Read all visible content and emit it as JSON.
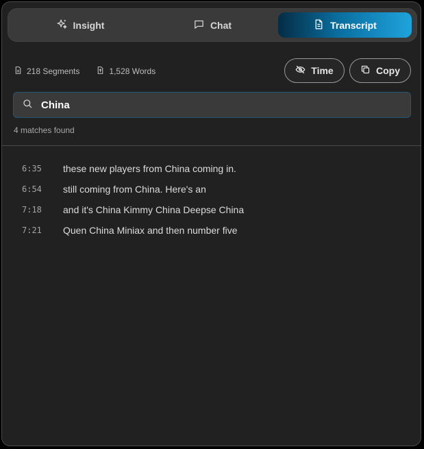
{
  "tabs": {
    "insight": "Insight",
    "chat": "Chat",
    "transcript": "Transcript",
    "active": "transcript"
  },
  "stats": {
    "segments": "218 Segments",
    "words": "1,528 Words"
  },
  "actions": {
    "time": "Time",
    "copy": "Copy"
  },
  "search": {
    "value": "China",
    "matches": "4 matches found"
  },
  "segments": [
    {
      "time": "6:35",
      "text": "these new players from China coming in."
    },
    {
      "time": "6:54",
      "text": "still coming from China. Here's an"
    },
    {
      "time": "7:18",
      "text": "and it's China Kimmy China Deepse China"
    },
    {
      "time": "7:21",
      "text": "Quen China Miniax and then number five"
    }
  ],
  "colors": {
    "accent_start": "#042c45",
    "accent_end": "#1fa3dd",
    "panel_bg": "#212121"
  }
}
